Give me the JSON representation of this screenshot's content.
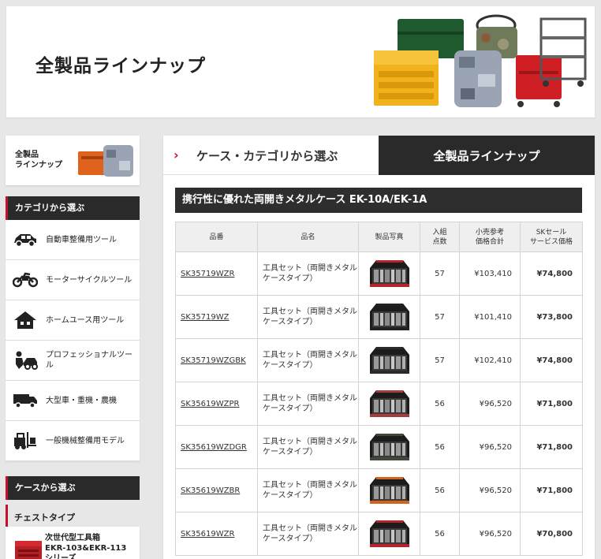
{
  "banner": {
    "title": "全製品ラインナップ"
  },
  "sidebar": {
    "lineup_card": {
      "label": "全製品\nラインナップ"
    },
    "category_heading": "カテゴリから選ぶ",
    "categories": [
      {
        "label": "自動車整備用ツール",
        "icon": "car-icon"
      },
      {
        "label": "モーターサイクルツール",
        "icon": "motorcycle-icon"
      },
      {
        "label": "ホームユース用ツール",
        "icon": "house-icon"
      },
      {
        "label": "プロフェッショナルツール",
        "icon": "mechanic-icon"
      },
      {
        "label": "大型車・重機・農機",
        "icon": "truck-icon"
      },
      {
        "label": "一般機械整備用モデル",
        "icon": "forklift-icon"
      }
    ],
    "case_heading": "ケースから選ぶ",
    "chest_heading": "チェストタイプ",
    "chest_item": {
      "label": "次世代型工具箱\nEKR-103&EKR-113\nシリーズ"
    }
  },
  "main": {
    "tabs": [
      {
        "label": "ケース・カテゴリから選ぶ",
        "active": false
      },
      {
        "label": "全製品ラインナップ",
        "active": true
      }
    ],
    "section_title": "携行性に優れた両開きメタルケース EK-10A/EK-1A",
    "table": {
      "headers": [
        "品番",
        "品名",
        "製品写真",
        "入組\n点数",
        "小売参考\n価格合計",
        "SKセール\nサービス価格"
      ],
      "rows": [
        {
          "code": "SK35719WZR",
          "name": "工具セット（両開きメタルケースタイプ）",
          "qty": "57",
          "retail": "¥103,410",
          "sale": "¥74,800",
          "accent": "#b3252b"
        },
        {
          "code": "SK35719WZ",
          "name": "工具セット（両開きメタルケースタイプ）",
          "qty": "57",
          "retail": "¥101,410",
          "sale": "¥73,800",
          "accent": "#222222"
        },
        {
          "code": "SK35719WZGBK",
          "name": "工具セット（両開きメタルケースタイプ）",
          "qty": "57",
          "retail": "¥102,410",
          "sale": "¥74,800",
          "accent": "#2a2a2a"
        },
        {
          "code": "SK35619WZPR",
          "name": "工具セット（両開きメタルケースタイプ）",
          "qty": "56",
          "retail": "¥96,520",
          "sale": "¥71,800",
          "accent": "#a63c3c"
        },
        {
          "code": "SK35619WZDGR",
          "name": "工具セット（両開きメタルケースタイプ）",
          "qty": "56",
          "retail": "¥96,520",
          "sale": "¥71,800",
          "accent": "#3f4a3a"
        },
        {
          "code": "SK35619WZBR",
          "name": "工具セット（両開きメタルケースタイプ）",
          "qty": "56",
          "retail": "¥96,520",
          "sale": "¥71,800",
          "accent": "#d2651e"
        },
        {
          "code": "SK35619WZR",
          "name": "工具セット（両開きメタルケースタイプ）",
          "qty": "56",
          "retail": "¥96,520",
          "sale": "¥70,800",
          "accent": "#b3252b"
        }
      ]
    }
  },
  "colors": {
    "accent_red": "#c8102e",
    "sale_red": "#e00000",
    "dark_bar": "#2a2a2a"
  }
}
